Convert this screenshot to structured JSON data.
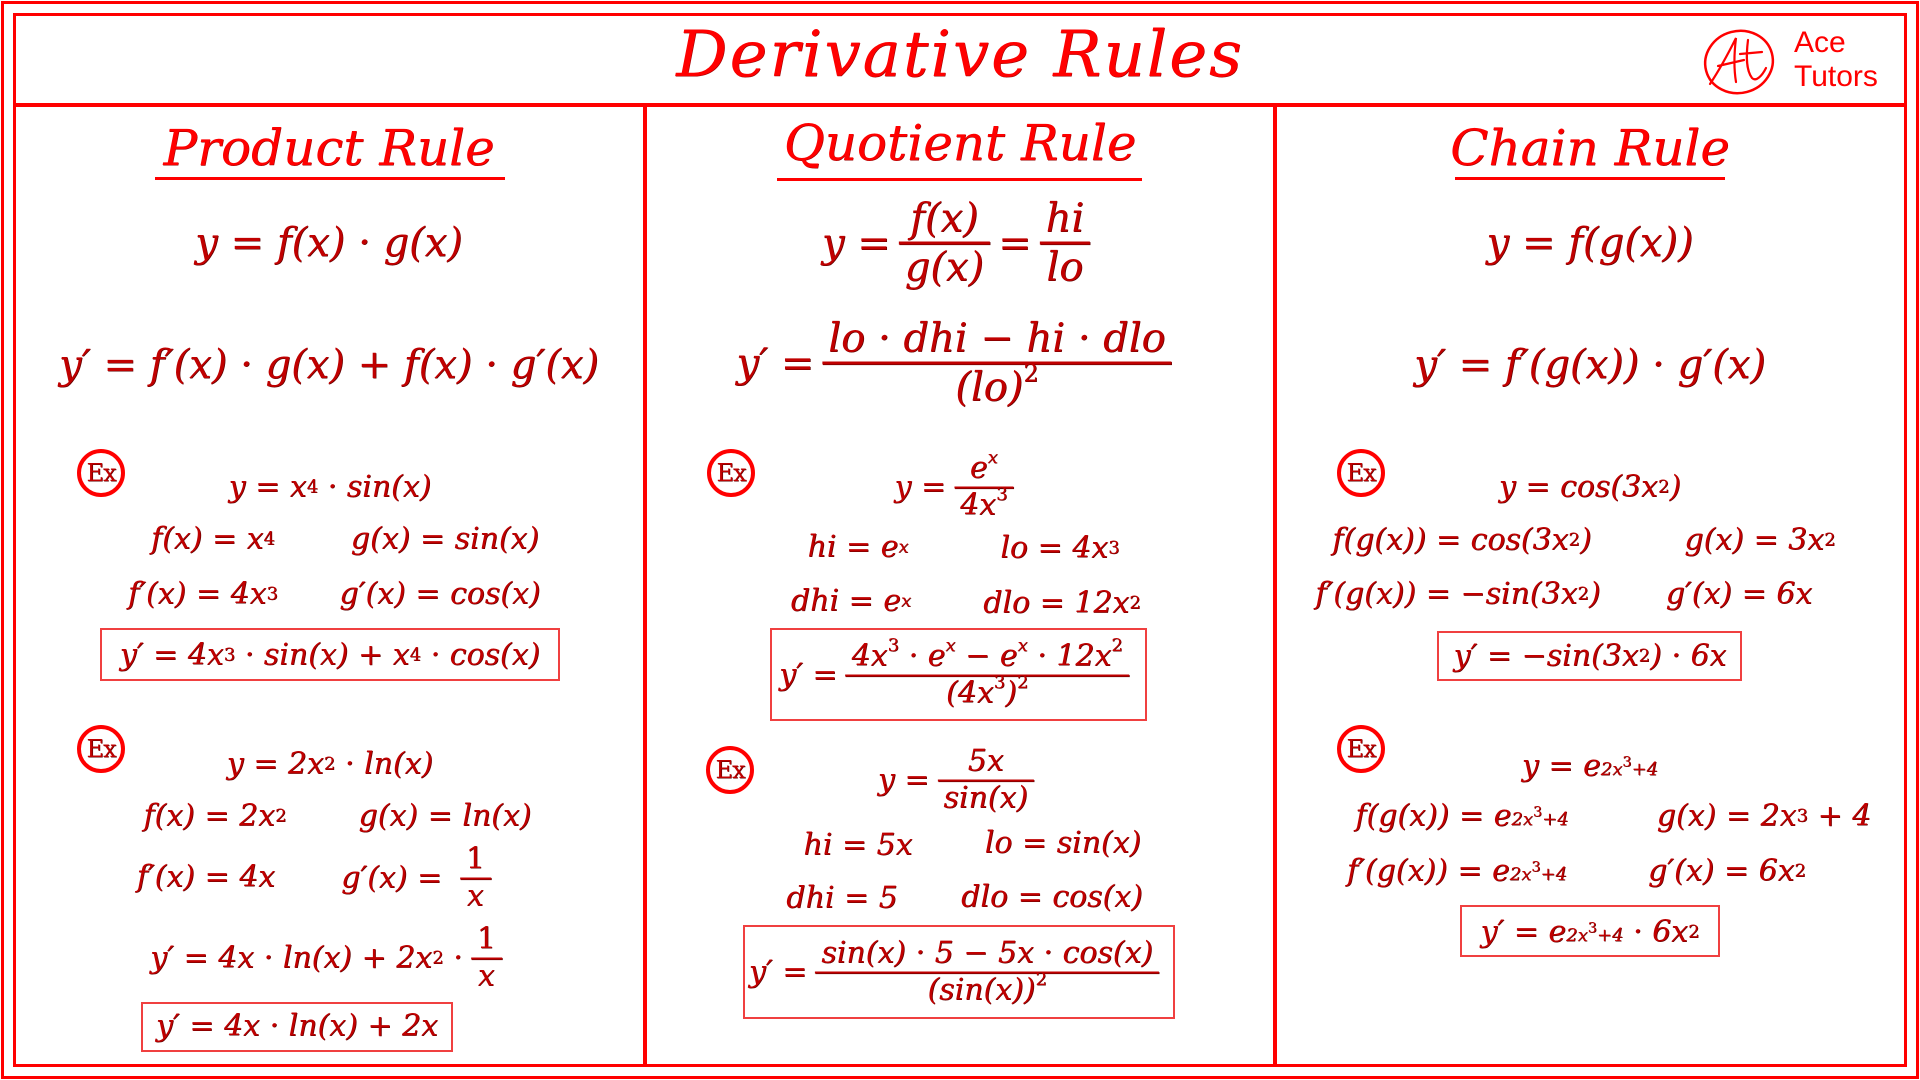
{
  "header": {
    "title": "Derivative Rules",
    "logo": {
      "icon": "ace-tutors-logo-icon",
      "monogram": "At",
      "line1": "Ace",
      "line2": "Tutors"
    }
  },
  "colors": {
    "frame": "#FF0000",
    "heading": "#FF0000",
    "formula": "#C00000",
    "answer_box": "#F04040"
  },
  "example_badge": "Ex",
  "columns": [
    {
      "heading": "Product Rule",
      "rule": "y = f(x) · g(x)",
      "derivative": "y′ = f′(x) · g(x) + f(x) · g′(x)",
      "examples": [
        {
          "function": "y = x⁴ · sin(x)",
          "parts": [
            "f(x) = x⁴",
            "g(x) = sin(x)",
            "f′(x) = 4x³",
            "g′(x) = cos(x)"
          ],
          "answer": "y′ = 4x³ · sin(x) + x⁴ · cos(x)"
        },
        {
          "function": "y = 2x² · ln(x)",
          "parts": [
            "f(x) = 2x²",
            "g(x) = ln(x)",
            "f′(x) = 4x",
            "g′(x) = 1/x"
          ],
          "step": "y′ = 4x · ln(x) + 2x² · 1/x",
          "answer": "y′ = 4x · ln(x) + 2x"
        }
      ]
    },
    {
      "heading": "Quotient Rule",
      "rule": "y = f(x)/g(x) = hi/lo",
      "derivative": "y′ = (lo · dhi − hi · dlo)/(lo)²",
      "examples": [
        {
          "function": "y = eˣ/4x³",
          "parts": [
            "hi = eˣ",
            "lo = 4x³",
            "dhi = eˣ",
            "dlo = 12x²"
          ],
          "answer": "y′ = (4x³ · eˣ − eˣ · 12x²)/(4x³)²"
        },
        {
          "function": "y = 5x/sin(x)",
          "parts": [
            "hi = 5x",
            "lo = sin(x)",
            "dhi = 5",
            "dlo = cos(x)"
          ],
          "answer": "y′ = (sin(x) · 5 − 5x · cos(x))/(sin(x))²"
        }
      ]
    },
    {
      "heading": "Chain Rule",
      "rule": "y = f(g(x))",
      "derivative": "y′ = f′(g(x)) · g′(x)",
      "examples": [
        {
          "function": "y = cos(3x²)",
          "parts": [
            "f(g(x)) = cos(3x²)",
            "g(x) = 3x²",
            "f′(g(x)) = −sin(3x²)",
            "g′(x) = 6x"
          ],
          "answer": "y′ = −sin(3x²) · 6x"
        },
        {
          "function": "y = e^(2x³+4)",
          "parts": [
            "f(g(x)) = e^(2x³+4)",
            "g(x) = 2x³ + 4",
            "f′(g(x)) = e^(2x³+4)",
            "g′(x) = 6x²"
          ],
          "answer": "y′ = e^(2x³+4) · 6x²"
        }
      ]
    }
  ]
}
